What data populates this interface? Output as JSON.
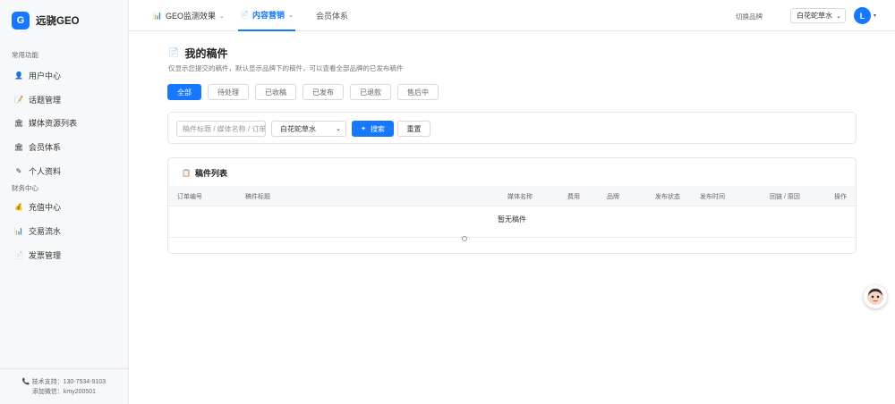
{
  "app": {
    "logo_letter": "G",
    "name": "远骁GEO"
  },
  "sidebar": {
    "section1_title": "常用功能",
    "section1_items": [
      {
        "label": "用户中心",
        "icon": "user-icon",
        "glyph": "👤"
      },
      {
        "label": "话题管理",
        "icon": "topic-icon",
        "glyph": "📝"
      },
      {
        "label": "媒体资源列表",
        "icon": "media-icon",
        "glyph": "🏛"
      },
      {
        "label": "会员体系",
        "icon": "member-icon",
        "glyph": "🏛"
      },
      {
        "label": "个人资料",
        "icon": "profile-icon",
        "glyph": "✎"
      }
    ],
    "section2_title": "财务中心",
    "section2_items": [
      {
        "label": "充值中心",
        "icon": "money-bag-icon",
        "glyph": "💰"
      },
      {
        "label": "交易流水",
        "icon": "chart-icon",
        "glyph": "📊"
      },
      {
        "label": "发票管理",
        "icon": "invoice-icon",
        "glyph": "📄"
      }
    ],
    "support_phone": "技术支持：130-7534-9103",
    "support_wechat": "添加微信：kmy200501"
  },
  "header": {
    "tabs": [
      {
        "label": "GEO监测效果",
        "icon": "chart-icon",
        "glyph": "📊",
        "chevron": "⌄"
      },
      {
        "label": "内容营销",
        "icon": "document-icon",
        "glyph": "📄",
        "chevron": "⌄"
      },
      {
        "label": "会员体系"
      }
    ],
    "brand_label": "切换品牌",
    "brand_value": "白花蛇草水",
    "avatar_letter": "L"
  },
  "main": {
    "title": "我的稿件",
    "subtitle": "仅显示您提交的稿件，默认显示品牌下的稿件，可以查看全部品牌的已发布稿件",
    "filters": [
      "全部",
      "待处理",
      "已收稿",
      "已发布",
      "已退款",
      "售后中"
    ],
    "search": {
      "placeholder": "稿件标题 / 媒体名称 / 订单号",
      "brand_select": "白花蛇草水",
      "search_label": "搜索",
      "reset_label": "重置"
    },
    "table": {
      "title": "稿件列表",
      "columns": [
        "订单编号",
        "稿件标题",
        "媒体名称",
        "费用",
        "品牌",
        "发布状态",
        "发布时间",
        "回链 / 原因",
        "操作"
      ],
      "empty_text": "暂无稿件"
    }
  },
  "colors": {
    "accent": "#1677ff",
    "sidebar_bg": "#f7f8fa"
  }
}
